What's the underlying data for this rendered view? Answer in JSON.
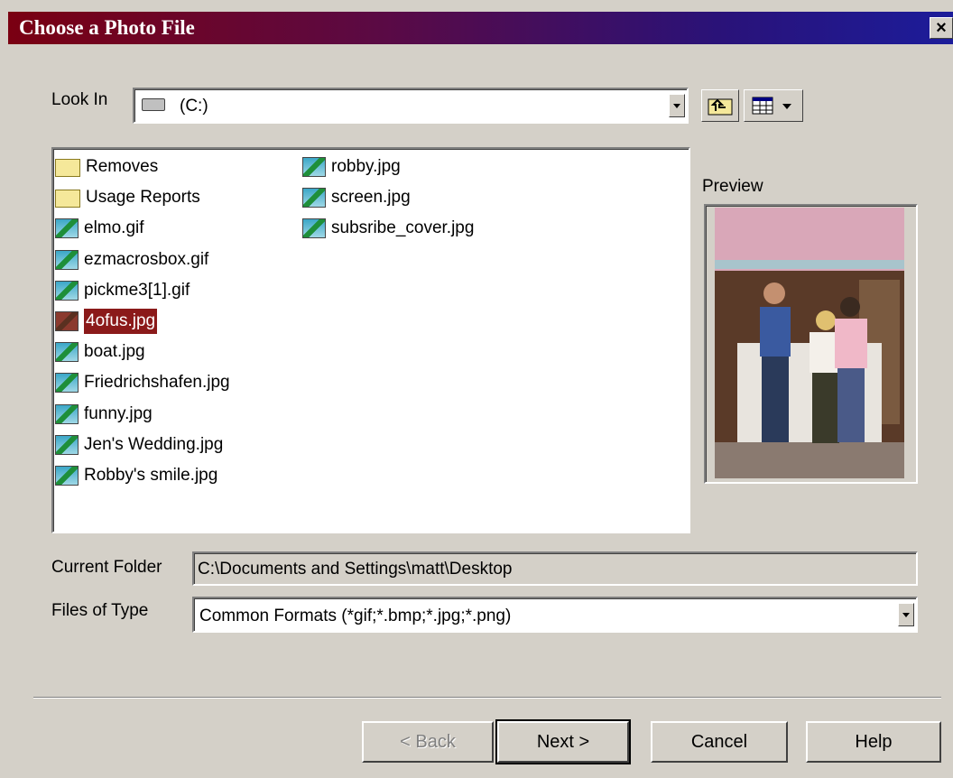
{
  "window": {
    "title": "Choose a Photo File",
    "close": "×"
  },
  "look_in": {
    "label": "Look In",
    "value": "(C:)"
  },
  "files": [
    {
      "name": "Removes",
      "type": "folder"
    },
    {
      "name": "Usage Reports",
      "type": "folder"
    },
    {
      "name": "elmo.gif",
      "type": "image"
    },
    {
      "name": "ezmacrosbox.gif",
      "type": "image"
    },
    {
      "name": "pickme3[1].gif",
      "type": "image"
    },
    {
      "name": "4ofus.jpg",
      "type": "image",
      "selected": true
    },
    {
      "name": "boat.jpg",
      "type": "image"
    },
    {
      "name": "Friedrichshafen.jpg",
      "type": "image"
    },
    {
      "name": "funny.jpg",
      "type": "image"
    },
    {
      "name": "Jen's Wedding.jpg",
      "type": "image"
    },
    {
      "name": "Robby's smile.jpg",
      "type": "image"
    },
    {
      "name": "robby.jpg",
      "type": "image"
    },
    {
      "name": "screen.jpg",
      "type": "image"
    },
    {
      "name": "subsribe_cover.jpg",
      "type": "image"
    }
  ],
  "preview": {
    "label": "Preview"
  },
  "current_folder": {
    "label": "Current Folder",
    "value": "C:\\Documents and Settings\\matt\\Desktop"
  },
  "files_of_type": {
    "label": "Files of Type",
    "value": "Common Formats (*gif;*.bmp;*.jpg;*.png)"
  },
  "buttons": {
    "back": "< Back",
    "next": "Next >",
    "cancel": "Cancel",
    "help": "Help"
  },
  "colors": {
    "title_start": "#7a0012",
    "title_end": "#1c1c9a",
    "selection": "#8b1a1a",
    "face": "#d4d0c8"
  }
}
